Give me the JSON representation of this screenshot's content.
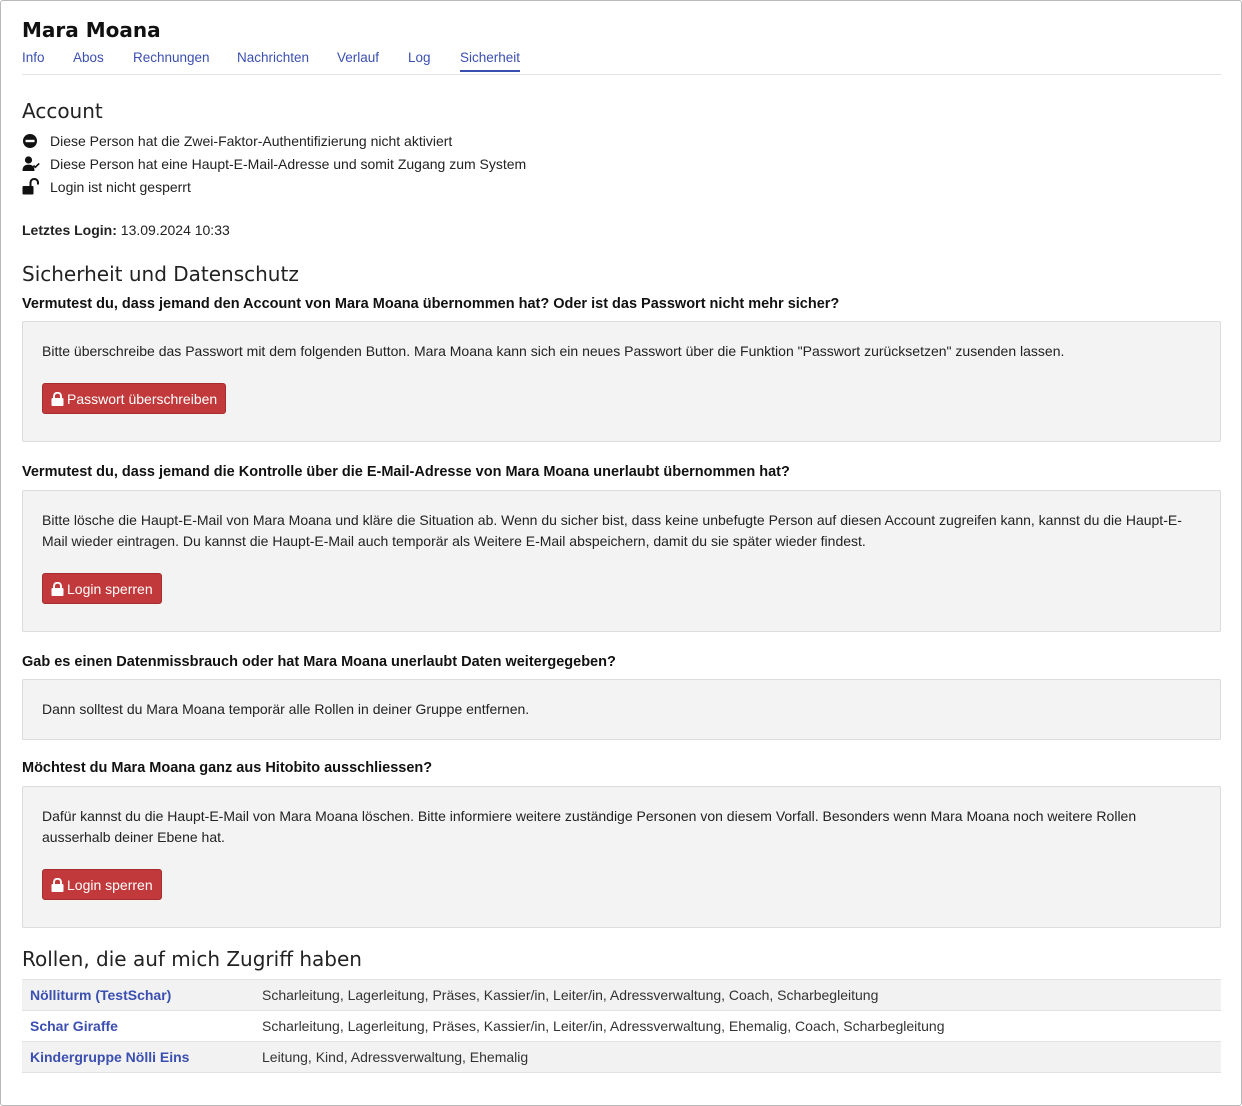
{
  "person": {
    "name": "Mara Moana"
  },
  "tabs": [
    {
      "label": "Info"
    },
    {
      "label": "Abos"
    },
    {
      "label": "Rechnungen"
    },
    {
      "label": "Nachrichten"
    },
    {
      "label": "Verlauf"
    },
    {
      "label": "Log"
    },
    {
      "label": "Sicherheit",
      "active": true
    }
  ],
  "account": {
    "heading": "Account",
    "statuses": [
      {
        "icon": "minus-circle-icon",
        "text": "Diese Person hat die Zwei-Faktor-Authentifizierung nicht aktiviert"
      },
      {
        "icon": "user-check-icon",
        "text": "Diese Person hat eine Haupt-E-Mail-Adresse und somit Zugang zum System"
      },
      {
        "icon": "unlock-icon",
        "text": "Login ist nicht gesperrt"
      }
    ],
    "last_login_label": "Letztes Login:",
    "last_login_value": "13.09.2024 10:33"
  },
  "security": {
    "heading": "Sicherheit und Datenschutz",
    "blocks": [
      {
        "question": "Vermutest du, dass jemand den Account von Mara Moana übernommen hat? Oder ist das Passwort nicht mehr sicher?",
        "text": "Bitte überschreibe das Passwort mit dem folgenden Button. Mara Moana kann sich ein neues Passwort über die Funktion \"Passwort zurücksetzen\" zusenden lassen.",
        "button": "Passwort überschreiben"
      },
      {
        "question": "Vermutest du, dass jemand die Kontrolle über die E-Mail-Adresse von Mara Moana unerlaubt übernommen hat?",
        "text": "Bitte lösche die Haupt-E-Mail von Mara Moana und kläre die Situation ab. Wenn du sicher bist, dass keine unbefugte Person auf diesen Account zugreifen kann, kannst du die Haupt-E-Mail wieder eintragen. Du kannst die Haupt-E-Mail auch temporär als Weitere E-Mail abspeichern, damit du sie später wieder findest.",
        "button": "Login sperren"
      },
      {
        "question": "Gab es einen Datenmissbrauch oder hat Mara Moana unerlaubt Daten weitergegeben?",
        "text": "Dann solltest du Mara Moana temporär alle Rollen in deiner Gruppe entfernen."
      },
      {
        "question": "Möchtest du Mara Moana ganz aus Hitobito ausschliessen?",
        "text": "Dafür kannst du die Haupt-E-Mail von Mara Moana löschen. Bitte informiere weitere zuständige Personen von diesem Vorfall. Besonders wenn Mara Moana noch weitere Rollen ausserhalb deiner Ebene hat.",
        "button": "Login sperren"
      }
    ]
  },
  "roles": {
    "heading": "Rollen, die auf mich Zugriff haben",
    "rows": [
      {
        "group": "Nölliturm (TestSchar)",
        "roles": "Scharleitung, Lagerleitung, Präses, Kassier/in, Leiter/in, Adressverwaltung, Coach, Scharbegleitung"
      },
      {
        "group": "Schar Giraffe",
        "roles": "Scharleitung, Lagerleitung, Präses, Kassier/in, Leiter/in, Adressverwaltung, Ehemalig, Coach, Scharbegleitung"
      },
      {
        "group": "Kindergruppe Nölli Eins",
        "roles": "Leitung, Kind, Adressverwaltung, Ehemalig"
      }
    ]
  },
  "colors": {
    "link": "#3b4fb0",
    "danger": "#c1393a",
    "panel_bg": "#f3f3f3"
  }
}
